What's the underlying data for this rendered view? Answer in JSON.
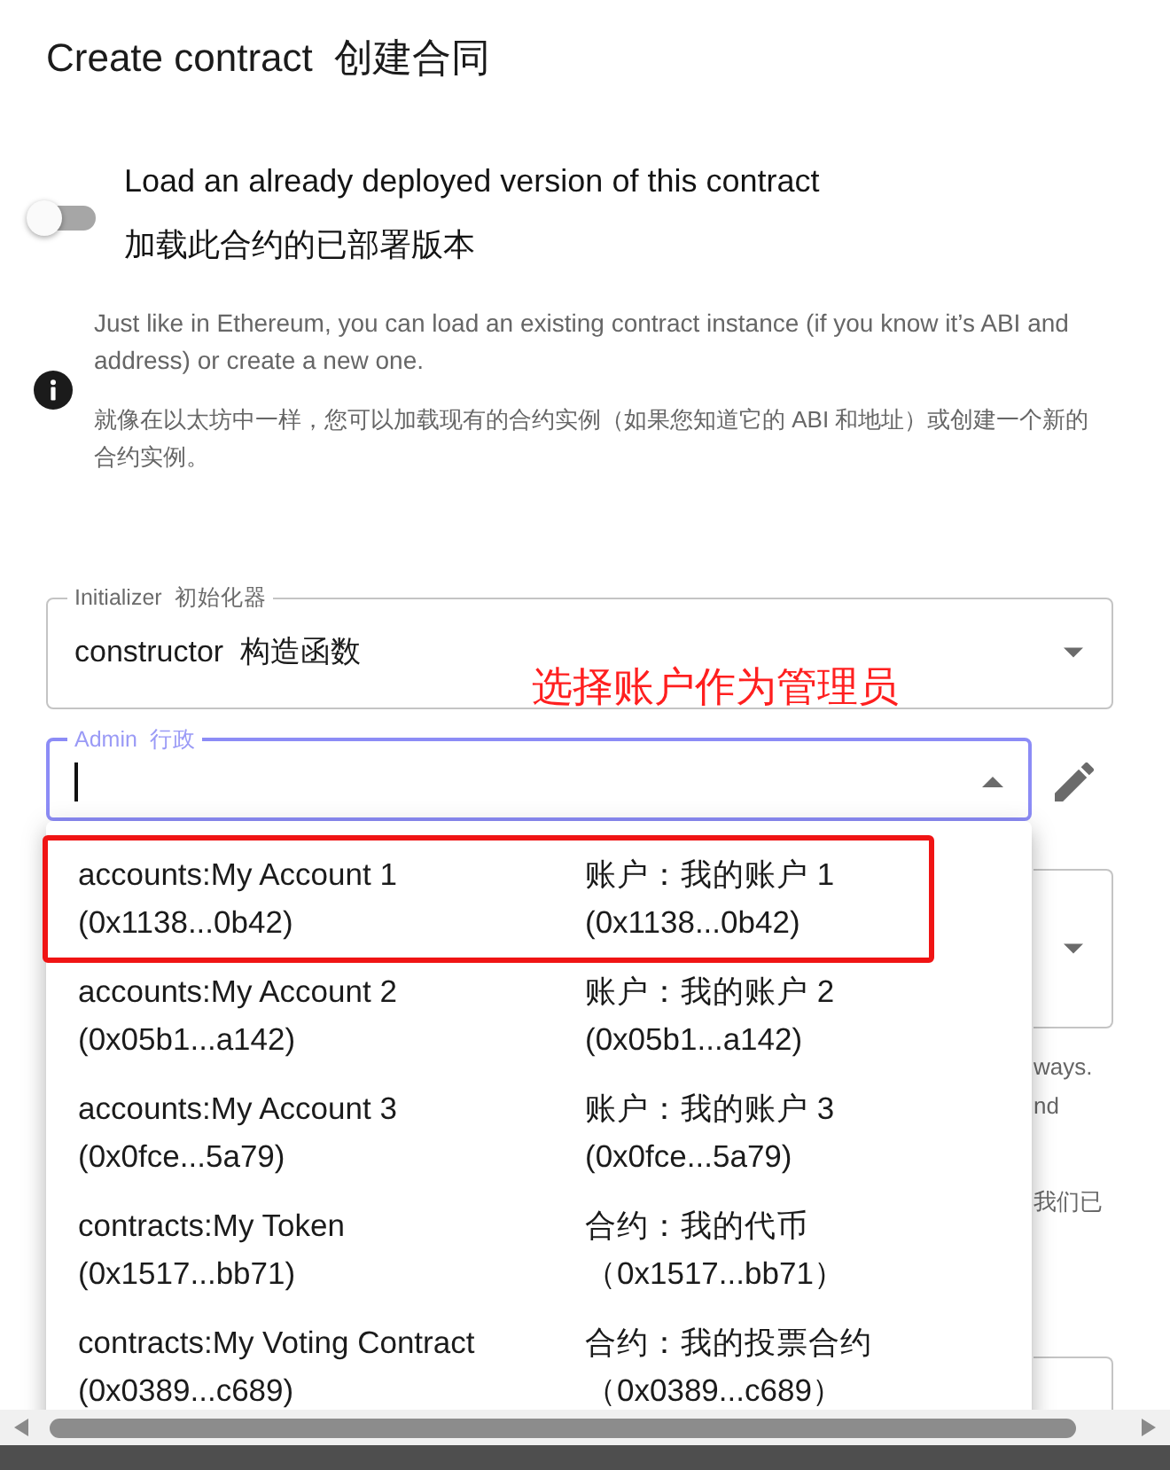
{
  "dialog": {
    "title": "Create contract  创建合同"
  },
  "load_existing": {
    "on": false,
    "label": "Load an already deployed version of this contract",
    "label_zh": "加载此合约的已部署版本"
  },
  "info": {
    "text": "Just like in Ethereum, you can load an existing contract instance (if you know it’s ABI and address) or create a new one.",
    "text_zh": "就像在以太坊中一样，您可以加载现有的合约实例（如果您知道它的 ABI 和地址）或创建一个新的合约实例。"
  },
  "initializer": {
    "label": "Initializer  初始化器",
    "value": "constructor  构造函数"
  },
  "annotation": {
    "text": "选择账户作为管理员"
  },
  "admin": {
    "label": "Admin  行政",
    "focused": true,
    "open": true,
    "options": [
      {
        "label": "accounts:My Account 1",
        "address": "(0x1138...0b42)",
        "label_zh": "账户：我的账户 1",
        "address_zh": "(0x1138...0b42)",
        "highlighted": true
      },
      {
        "label": "accounts:My Account 2",
        "address": "(0x05b1...a142)",
        "label_zh": "账户：我的账户 2",
        "address_zh": "(0x05b1...a142)",
        "highlighted": false
      },
      {
        "label": "accounts:My Account 3",
        "address": "(0x0fce...5a79)",
        "label_zh": "账户：我的账户 3",
        "address_zh": "(0x0fce...5a79)",
        "highlighted": false
      },
      {
        "label": "contracts:My Token",
        "address": "(0x1517...bb71)",
        "label_zh": "合约：我的代币",
        "address_zh": "（0x1517...bb71）",
        "highlighted": false
      },
      {
        "label": "contracts:My Voting Contract",
        "address": "(0x0389...c689)",
        "label_zh": "合约：我的投票合约",
        "address_zh": "（0x0389...c689）",
        "highlighted": false
      }
    ]
  },
  "covered_form": [
    {
      "kind": "select"
    },
    {
      "kind": "text",
      "text": "ways."
    },
    {
      "kind": "text",
      "text": "nd"
    },
    {
      "kind": "text",
      "text": "我们已"
    },
    {
      "kind": "field"
    }
  ]
}
